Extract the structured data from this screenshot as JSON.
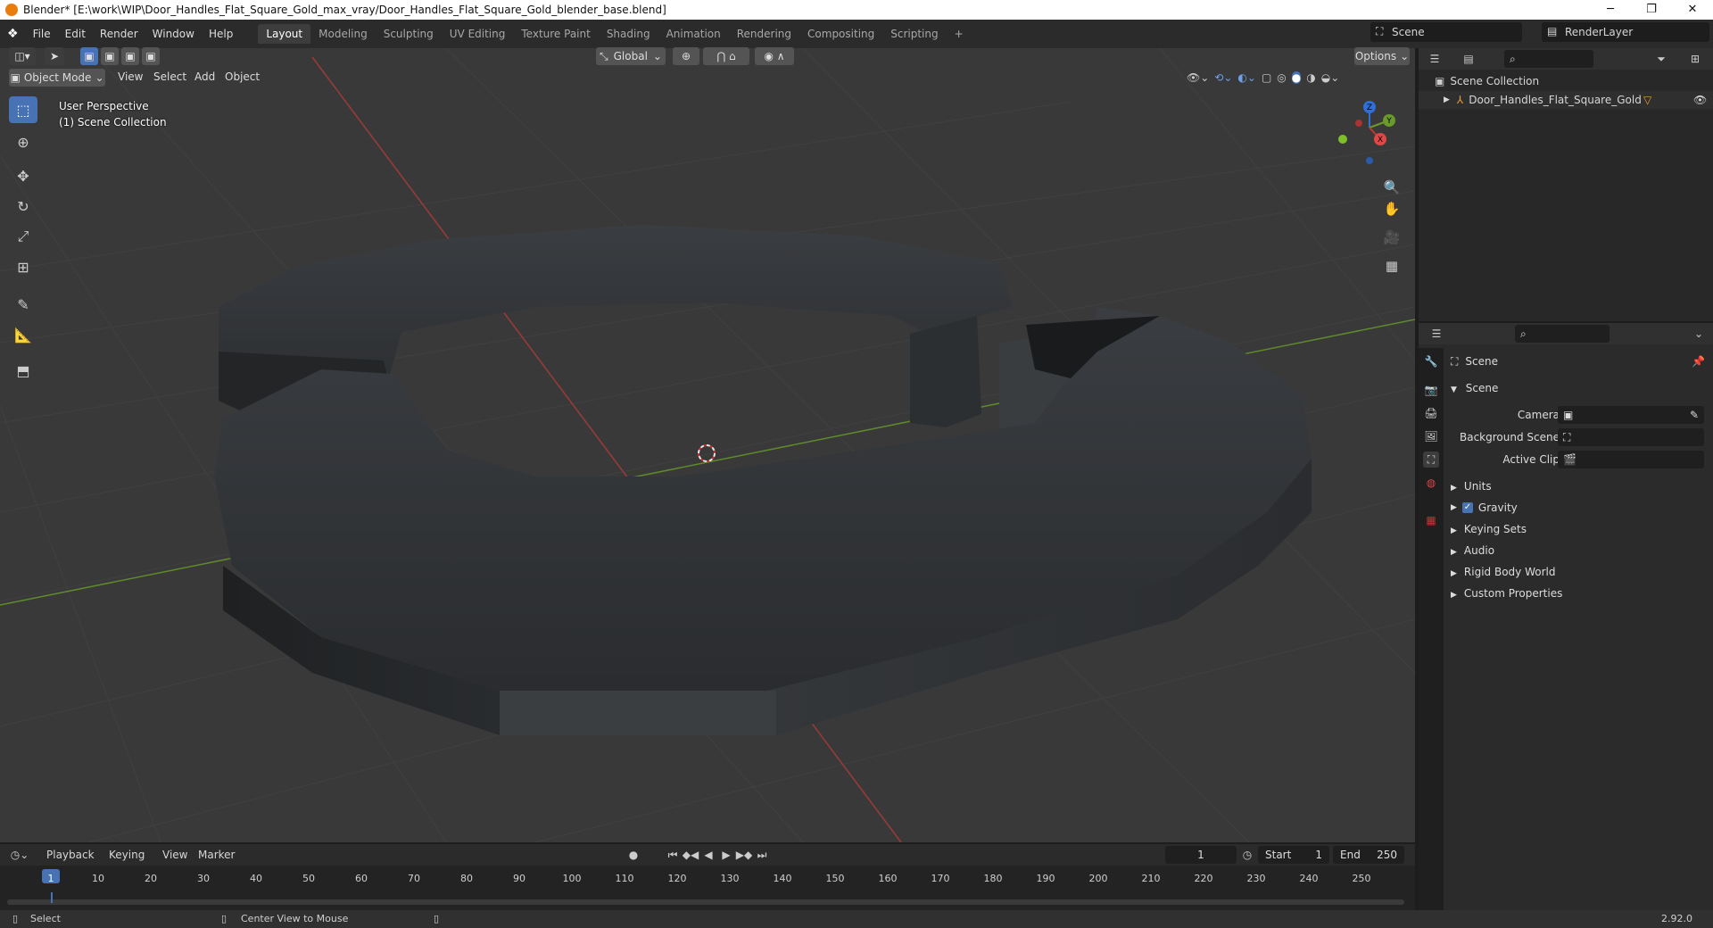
{
  "window": {
    "title": "Blender* [E:\\work\\WIP\\Door_Handles_Flat_Square_Gold_max_vray/Door_Handles_Flat_Square_Gold_blender_base.blend]",
    "minimize": "─",
    "restore": "❐",
    "close": "✕"
  },
  "menu": [
    "File",
    "Edit",
    "Render",
    "Window",
    "Help"
  ],
  "workspaces": [
    "Layout",
    "Modeling",
    "Sculpting",
    "UV Editing",
    "Texture Paint",
    "Shading",
    "Animation",
    "Rendering",
    "Compositing",
    "Scripting"
  ],
  "active_workspace": "Layout",
  "add_tab": "+",
  "scene_name": "Scene",
  "render_layer": "RenderLayer",
  "viewport": {
    "mode": "Object Mode",
    "menus": [
      "View",
      "Select",
      "Add",
      "Object"
    ],
    "transform_orientation": "Global",
    "options_label": "Options",
    "perspective_label": "User Perspective",
    "collection_label": "(1) Scene Collection",
    "gizmo_axes": {
      "x": "X",
      "y": "Y",
      "z": "Z"
    }
  },
  "outliner": {
    "root": "Scene Collection",
    "items": [
      {
        "name": "Door_Handles_Flat_Square_Gold"
      }
    ]
  },
  "properties": {
    "context": "Scene",
    "panel_title": "Scene",
    "fields": [
      {
        "label": "Camera",
        "value": ""
      },
      {
        "label": "Background Scene",
        "value": ""
      },
      {
        "label": "Active Clip",
        "value": ""
      }
    ],
    "sections": [
      "Units",
      "Gravity",
      "Keying Sets",
      "Audio",
      "Rigid Body World",
      "Custom Properties"
    ],
    "gravity_checked": true
  },
  "timeline": {
    "menus": [
      "Playback",
      "Keying",
      "View",
      "Marker"
    ],
    "current_frame": "1",
    "start_label": "Start",
    "start": "1",
    "end_label": "End",
    "end": "250",
    "ticks": [
      "1",
      "10",
      "20",
      "30",
      "40",
      "50",
      "60",
      "70",
      "80",
      "90",
      "100",
      "110",
      "120",
      "130",
      "140",
      "150",
      "160",
      "170",
      "180",
      "190",
      "200",
      "210",
      "220",
      "230",
      "240",
      "250"
    ]
  },
  "status": {
    "left": "Select",
    "middle": "Center View to Mouse",
    "version": "2.92.0"
  },
  "colors": {
    "accent": "#4772b3",
    "x_axis": "#c0392b",
    "y_axis": "#6a9a2a",
    "z_axis": "#2f6fd6",
    "object": "#2e3033"
  }
}
